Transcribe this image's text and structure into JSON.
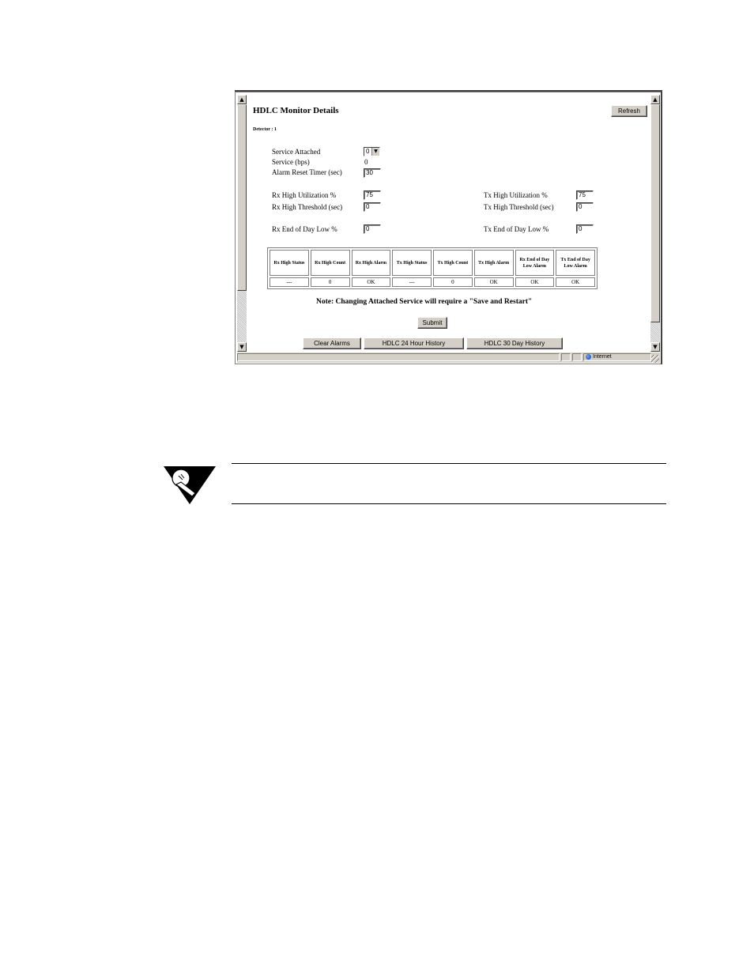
{
  "page": {
    "title": "HDLC Monitor Details",
    "refresh_label": "Refresh",
    "detector_label": "Detector : 1"
  },
  "service": {
    "attached_label": "Service Attached",
    "attached_value": "0",
    "bps_label": "Service (bps)",
    "bps_value": "0",
    "alarm_reset_label": "Alarm Reset Timer (sec)",
    "alarm_reset_value": "30"
  },
  "rx": {
    "high_util_label": "Rx High Utilization %",
    "high_util_value": "75",
    "high_threshold_label": "Rx High Threshold (sec)",
    "high_threshold_value": "0",
    "eod_low_label": "Rx End of Day Low %",
    "eod_low_value": "0"
  },
  "tx": {
    "high_util_label": "Tx High Utilization %",
    "high_util_value": "75",
    "high_threshold_label": "Tx High Threshold (sec)",
    "high_threshold_value": "0",
    "eod_low_label": "Tx End of Day Low %",
    "eod_low_value": "0"
  },
  "status_table": {
    "headers": [
      "Rx High Status",
      "Rx High Count",
      "Rx High Alarm",
      "Tx High Status",
      "Tx High Count",
      "Tx High Alarm",
      "Rx End of Day Low Alarm",
      "Tx End of Day Low Alarm"
    ],
    "values": [
      "---",
      "0",
      "OK",
      "---",
      "0",
      "OK",
      "OK",
      "OK"
    ]
  },
  "note": "Note:  Changing Attached Service will require a \"Save and Restart\"",
  "buttons": {
    "submit": "Submit",
    "clear_alarms": "Clear Alarms",
    "history_24h": "HDLC 24 Hour History",
    "history_30d": "HDLC 30 Day History"
  },
  "statusbar": {
    "zone": "Internet"
  },
  "colors": {
    "button_face": "#d4d0c8",
    "border_dark": "#404040",
    "border_mid": "#808080"
  }
}
